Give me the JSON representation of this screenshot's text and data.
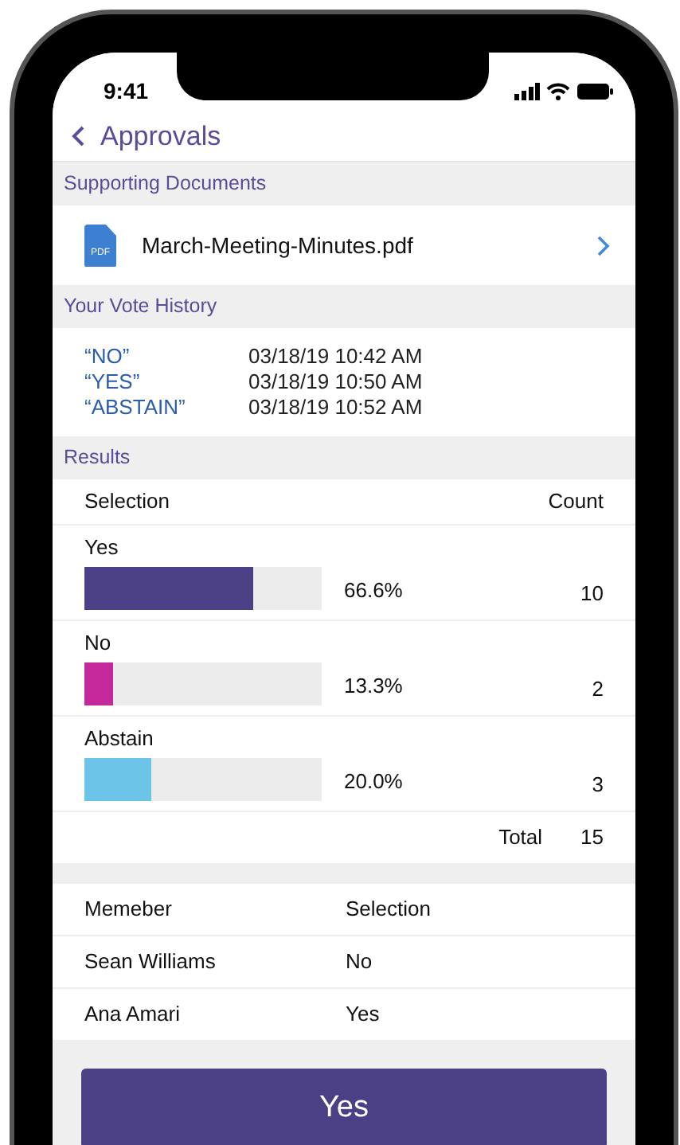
{
  "status_bar": {
    "time": "9:41"
  },
  "nav": {
    "title": "Approvals"
  },
  "supporting_documents": {
    "header": "Supporting Documents",
    "files": [
      {
        "name": "March-Meeting-Minutes.pdf",
        "icon_label": "PDF"
      }
    ]
  },
  "vote_history": {
    "header": "Your Vote History",
    "entries": [
      {
        "vote": "“NO”",
        "time": "03/18/19 10:42 AM"
      },
      {
        "vote": "“YES”",
        "time": "03/18/19 10:50 AM"
      },
      {
        "vote": "“ABSTAIN”",
        "time": "03/18/19 10:52 AM"
      }
    ]
  },
  "results": {
    "header": "Results",
    "columns": [
      "Selection",
      "Count"
    ],
    "options": [
      {
        "label": "Yes",
        "level": 0.71,
        "color": "#4b3f85",
        "percent": "66.6%",
        "count": "10"
      },
      {
        "label": "No",
        "level": 0.12,
        "color": "#c4289b",
        "percent": "13.3%",
        "count": "2"
      },
      {
        "label": "Abstain",
        "level": 0.28,
        "color": "#6cc4e8",
        "percent": "20.0%",
        "count": "3"
      }
    ],
    "total_label": "Total",
    "total": "15"
  },
  "members": {
    "columns": [
      "Memeber",
      "Selection"
    ],
    "rows": [
      [
        "Sean Williams",
        "No"
      ],
      [
        "Ana Amari",
        "Yes"
      ]
    ]
  },
  "vote_button": {
    "label": "Yes"
  }
}
